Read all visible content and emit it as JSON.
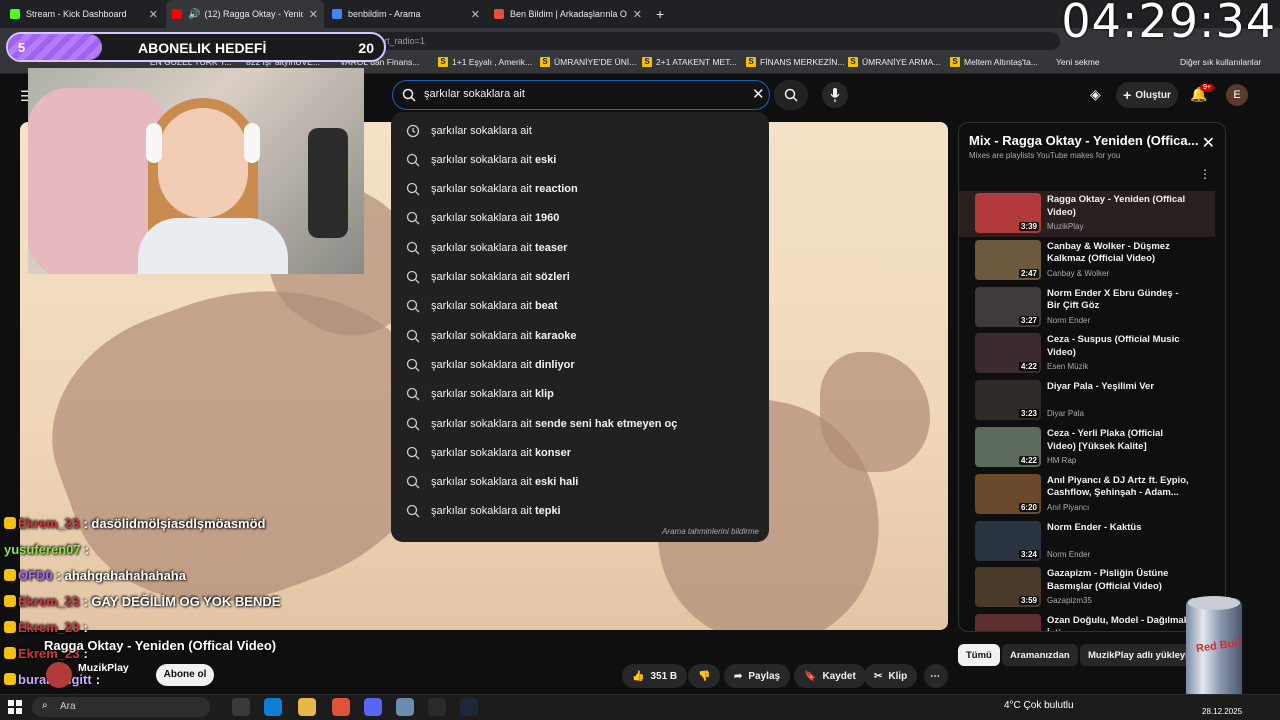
{
  "browser": {
    "tabs": [
      {
        "label": "Stream - Kick Dashboard",
        "favicon_color": "#53fc18"
      },
      {
        "label": "(12) Ragga Oktay - Yeniden (O",
        "favicon_color": "#ff0000"
      },
      {
        "label": "benbildim - Arama",
        "favicon_color": "#4285f4"
      },
      {
        "label": "Ben Bildim | Arkadaşlarınla Online",
        "favicon_color": "#e0533a"
      }
    ],
    "url": "www.youtube.com/watch?v=RsO_09ys1nU&list=RDRsQ_09ys1nU&start_radio=1",
    "bookmarks": [
      "EN GÜZEL TÜRK Y...",
      "822 İşi 'altyınUVE...",
      "VAROL dan Finans...",
      "1+1 Eşyalı , Amerik...",
      "ÜMRANİYE'DE ÜNİ...",
      "2+1 ATAKENT MET...",
      "FİNANS MERKEZİN...",
      "ÜMRANİYE ARMA...",
      "Meltem Altıntaş'ta...",
      "Yeni sekme",
      "Diğer sık kullanılanlar"
    ]
  },
  "overlay": {
    "clock": "04:29:34",
    "goal": {
      "current": "5",
      "title": "ABONELIK HEDEFİ",
      "target": "20",
      "progress": 0.25
    }
  },
  "youtube": {
    "search_value": "şarkılar sokaklara ait",
    "create_label": "Oluştur",
    "notif_count": "9+",
    "avatar_letter": "E",
    "suggestions": [
      {
        "base": "şarkılar sokaklara ait",
        "bold": "",
        "icon": "history-icon"
      },
      {
        "base": "şarkılar sokaklara ait ",
        "bold": "eski",
        "icon": "search-icon"
      },
      {
        "base": "şarkılar sokaklara ait ",
        "bold": "reaction",
        "icon": "search-icon"
      },
      {
        "base": "şarkılar sokaklara ait ",
        "bold": "1960",
        "icon": "search-icon"
      },
      {
        "base": "şarkılar sokaklara ait ",
        "bold": "teaser",
        "icon": "search-icon"
      },
      {
        "base": "şarkılar sokaklara ait ",
        "bold": "sözleri",
        "icon": "search-icon"
      },
      {
        "base": "şarkılar sokaklara ait ",
        "bold": "beat",
        "icon": "search-icon"
      },
      {
        "base": "şarkılar sokaklara ait ",
        "bold": "karaoke",
        "icon": "search-icon"
      },
      {
        "base": "şarkılar sokaklara ait ",
        "bold": "dinliyor",
        "icon": "search-icon"
      },
      {
        "base": "şarkılar sokaklara ait ",
        "bold": "klip",
        "icon": "search-icon"
      },
      {
        "base": "şarkılar sokaklara ait ",
        "bold": "sende seni hak etmeyen oç",
        "icon": "search-icon"
      },
      {
        "base": "şarkılar sokaklara ait ",
        "bold": "konser",
        "icon": "search-icon"
      },
      {
        "base": "şarkılar sokaklara ait ",
        "bold": "eski hali",
        "icon": "search-icon"
      },
      {
        "base": "şarkılar sokaklara ait ",
        "bold": "tepki",
        "icon": "search-icon"
      }
    ],
    "suggest_footer": "Arama tahminlerini bildirme",
    "video_title": "Ragga Oktay - Yeniden (Offical Video)",
    "channel": "MuzikPlay",
    "subscribe_label": "Abone ol",
    "actions": {
      "likes": "351 B",
      "share": "Paylaş",
      "save": "Kaydet",
      "clip": "Klip"
    },
    "playlist": {
      "title": "Mix - Ragga Oktay - Yeniden (Offica...",
      "subtitle": "Mixes are playlists YouTube makes for you",
      "items": [
        {
          "title": "Ragga Oktay - Yeniden (Offical Video)",
          "channel": "MuzikPlay",
          "duration": "3:39",
          "thumb": "#b23a3a"
        },
        {
          "title": "Canbay & Wolker - Düşmez Kalkmaz (Official Video)",
          "channel": "Canbay & Wolker",
          "duration": "2:47",
          "thumb": "#6b5a3d"
        },
        {
          "title": "Norm Ender X Ebru Gündeş - Bir Çift Göz",
          "channel": "Norm Ender",
          "duration": "3:27",
          "thumb": "#3d3a39"
        },
        {
          "title": "Ceza - Suspus (Official Music Video)",
          "channel": "Esen Müzik",
          "duration": "4:22",
          "thumb": "#3b2a30"
        },
        {
          "title": "Diyar Pala - Yeşilimi Ver",
          "channel": "Diyar Pala",
          "duration": "3:23",
          "thumb": "#2e2b27"
        },
        {
          "title": "Ceza - Yerli Plaka (Official Video) [Yüksek Kalite]",
          "channel": "HM Rap",
          "duration": "4:22",
          "thumb": "#5b6a5a"
        },
        {
          "title": "Anıl Piyancı & DJ Artz ft. Eypio, Cashflow, Şehinşah - Adam...",
          "channel": "Anıl Piyancı",
          "duration": "6:20",
          "thumb": "#6a4a2a"
        },
        {
          "title": "Norm Ender - Kaktüs",
          "channel": "Norm Ender",
          "duration": "3:24",
          "thumb": "#2a3440"
        },
        {
          "title": "Gazapizm - Pisliğin Üstüne Basmışlar (Official Video)",
          "channel": "Gazapizm35",
          "duration": "3:59",
          "thumb": "#4a3a2a"
        },
        {
          "title": "Ozan Doğulu, Model - Dağılmak İstiyorum",
          "channel": "",
          "duration": "",
          "thumb": "#5a3030"
        }
      ]
    },
    "chips": [
      "Tümü",
      "Aramanızdan",
      "MuzikPlay adlı yükleyic"
    ]
  },
  "chat": [
    {
      "user": "Ekrem_23",
      "msg": ": dasölidmölşiasdlşmöasmöd",
      "color": "#d4343f"
    },
    {
      "user": "yusuferen07",
      "msg": ":",
      "color": "#8be34a"
    },
    {
      "user": "OFD0",
      "msg": ": ahahgahahahahaha",
      "color": "#a968ff"
    },
    {
      "user": "Ekrem_23",
      "msg": ": GAY DEĞİLİM OG YOK BENDE",
      "color": "#d4343f"
    },
    {
      "user": "Ekrem_23",
      "msg": ":",
      "color": "#d4343f"
    },
    {
      "user": "Ekrem_23",
      "msg": ":",
      "color": "#d4343f"
    },
    {
      "user": "burak_yigitt",
      "msg": ":",
      "color": "#c8a8ff"
    }
  ],
  "taskbar": {
    "search_placeholder": "Ara",
    "weather": "4°C  Çok bulutlu",
    "date": "28.12.2025"
  }
}
